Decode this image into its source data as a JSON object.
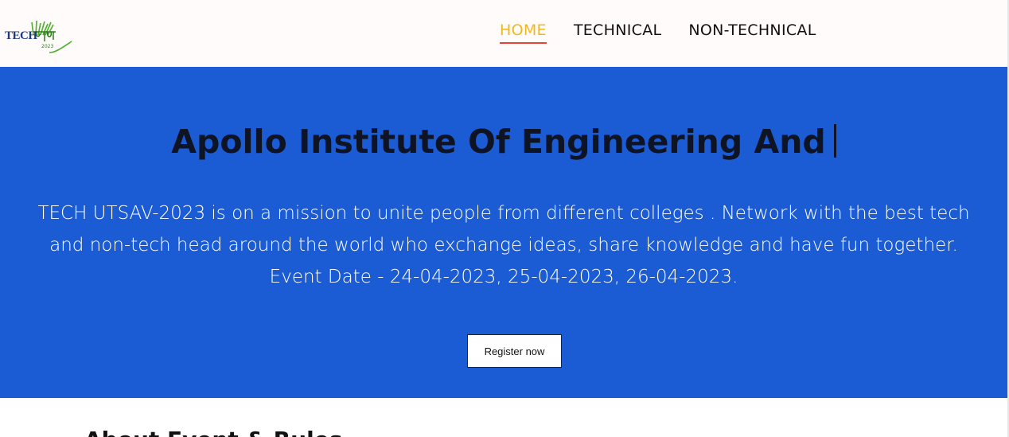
{
  "logo": {
    "text": "TECH",
    "alt_text": "TECH उत्सव"
  },
  "nav": {
    "items": [
      {
        "label": "HOME",
        "active": true
      },
      {
        "label": "TECHNICAL",
        "active": false
      },
      {
        "label": "NON-TECHNICAL",
        "active": false
      }
    ]
  },
  "hero": {
    "title": "Apollo Institute Of Engineering And",
    "description_lines": [
      "TECH UTSAV-2023 is on a mission to unite people from different colleges . Network with the best tech",
      "and non-tech head around the world who exchange ideas, share knowledge and have fun together.",
      "Event Date - 24-04-2023, 25-04-2023, 26-04-2023."
    ],
    "register_label": "Register now"
  },
  "next_section": {
    "heading": "About Event & Rules"
  },
  "colors": {
    "hero_bg": "#1b5bd3",
    "nav_active": "#f0b81e",
    "nav_underline": "#e8433a",
    "navbar_bg": "#fffbfa"
  },
  "icons": {
    "logo": "tech-utsav-logo"
  }
}
